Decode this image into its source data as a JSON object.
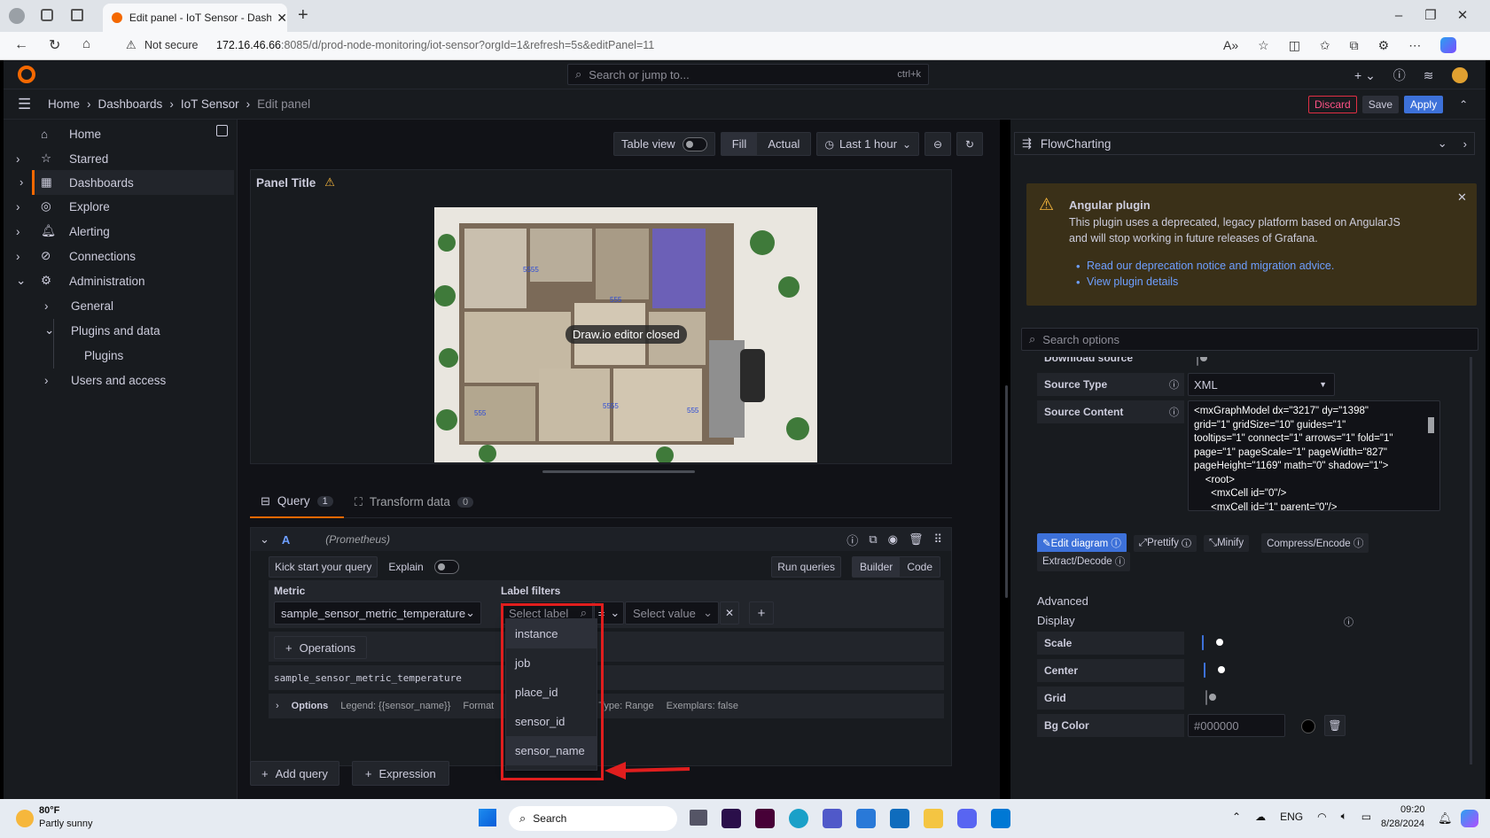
{
  "browser": {
    "tab_title": "Edit panel - IoT Sensor - Dashboa",
    "security": "Not secure",
    "url_host": "172.16.46.66",
    "url_rest": ":8085/d/prod-node-monitoring/iot-sensor?orgId=1&refresh=5s&editPanel=11"
  },
  "topbar": {
    "search_placeholder": "Search or jump to...",
    "search_shortcut": "ctrl+k"
  },
  "breadcrumb": {
    "items": [
      "Home",
      "Dashboards",
      "IoT Sensor",
      "Edit panel"
    ],
    "discard": "Discard",
    "save": "Save",
    "apply": "Apply"
  },
  "sidebar": {
    "items": [
      {
        "label": "Home",
        "icon": "home-icon"
      },
      {
        "label": "Starred",
        "icon": "star-icon"
      },
      {
        "label": "Dashboards",
        "icon": "grid-icon"
      },
      {
        "label": "Explore",
        "icon": "compass-icon"
      },
      {
        "label": "Alerting",
        "icon": "bell-icon"
      },
      {
        "label": "Connections",
        "icon": "link-icon"
      },
      {
        "label": "Administration",
        "icon": "gear-icon"
      }
    ],
    "sub_items": [
      "General",
      "Plugins and data",
      "Plugins",
      "Users and access"
    ]
  },
  "panel_toolbar": {
    "table_view": "Table view",
    "fill": "Fill",
    "actual": "Actual",
    "time_range": "Last 1 hour"
  },
  "panel": {
    "title": "Panel Title",
    "overlay": "Draw.io editor closed",
    "room_labels": [
      "5555",
      "555",
      "5555",
      "555",
      "555"
    ]
  },
  "query_tabs": {
    "query": "Query",
    "query_count": "1",
    "transform": "Transform data",
    "transform_count": "0"
  },
  "query": {
    "ref": "A",
    "datasource": "(Prometheus)",
    "kick_start": "Kick start your query",
    "explain": "Explain",
    "run_queries": "Run queries",
    "builder": "Builder",
    "code": "Code",
    "metric_label": "Metric",
    "metric_value": "sample_sensor_metric_temperature",
    "label_filters": "Label filters",
    "select_label": "Select label",
    "operator": "=",
    "select_value": "Select value",
    "operations": "Operations",
    "raw_query": "sample_sensor_metric_temperature",
    "options": "Options",
    "legend": "Legend: {{sensor_name}}",
    "format": "Format",
    "type": "Type: Range",
    "exemplars": "Exemplars: false",
    "add_query": "Add query",
    "expression": "Expression"
  },
  "label_dropdown": {
    "options": [
      "instance",
      "job",
      "place_id",
      "sensor_id",
      "sensor_name"
    ]
  },
  "right_panel": {
    "visualization": "FlowCharting",
    "alert_title": "Angular plugin",
    "alert_text_1": "This plugin uses a deprecated, legacy platform based on AngularJS",
    "alert_text_2": "and will stop working in future releases of Grafana.",
    "alert_link_1": "Read our deprecation notice and migration advice.",
    "alert_link_2": "View plugin details",
    "search_placeholder": "Search options",
    "download_source": "Download source",
    "source_type_label": "Source Type",
    "source_type_value": "XML",
    "source_content_label": "Source Content",
    "source_content_lines": [
      "<mxGraphModel dx=\"3217\" dy=\"1398\"",
      "grid=\"1\" gridSize=\"10\" guides=\"1\"",
      "tooltips=\"1\" connect=\"1\" arrows=\"1\" fold=\"1\"",
      "page=\"1\" pageScale=\"1\" pageWidth=\"827\"",
      "pageHeight=\"1169\" math=\"0\" shadow=\"1\">",
      "    <root>",
      "      <mxCell id=\"0\"/>",
      "      <mxCell id=\"1\" parent=\"0\"/>"
    ],
    "edit_diagram": "Edit diagram",
    "prettify": "Prettify",
    "minify": "Minify",
    "compress": "Compress/Encode",
    "extract": "Extract/Decode",
    "advanced": "Advanced",
    "display": "Display",
    "scale": "Scale",
    "center": "Center",
    "grid": "Grid",
    "bg_color_label": "Bg Color",
    "bg_color_value": "#000000"
  },
  "taskbar": {
    "temp": "80°F",
    "weather": "Partly sunny",
    "search": "Search",
    "lang": "ENG",
    "time": "09:20",
    "date": "8/28/2024"
  },
  "colors": {
    "accent_blue": "#3d71d9",
    "discard_red": "#e02f44",
    "highlight_red": "#e01e1e",
    "alert_bg": "#3a3018"
  }
}
